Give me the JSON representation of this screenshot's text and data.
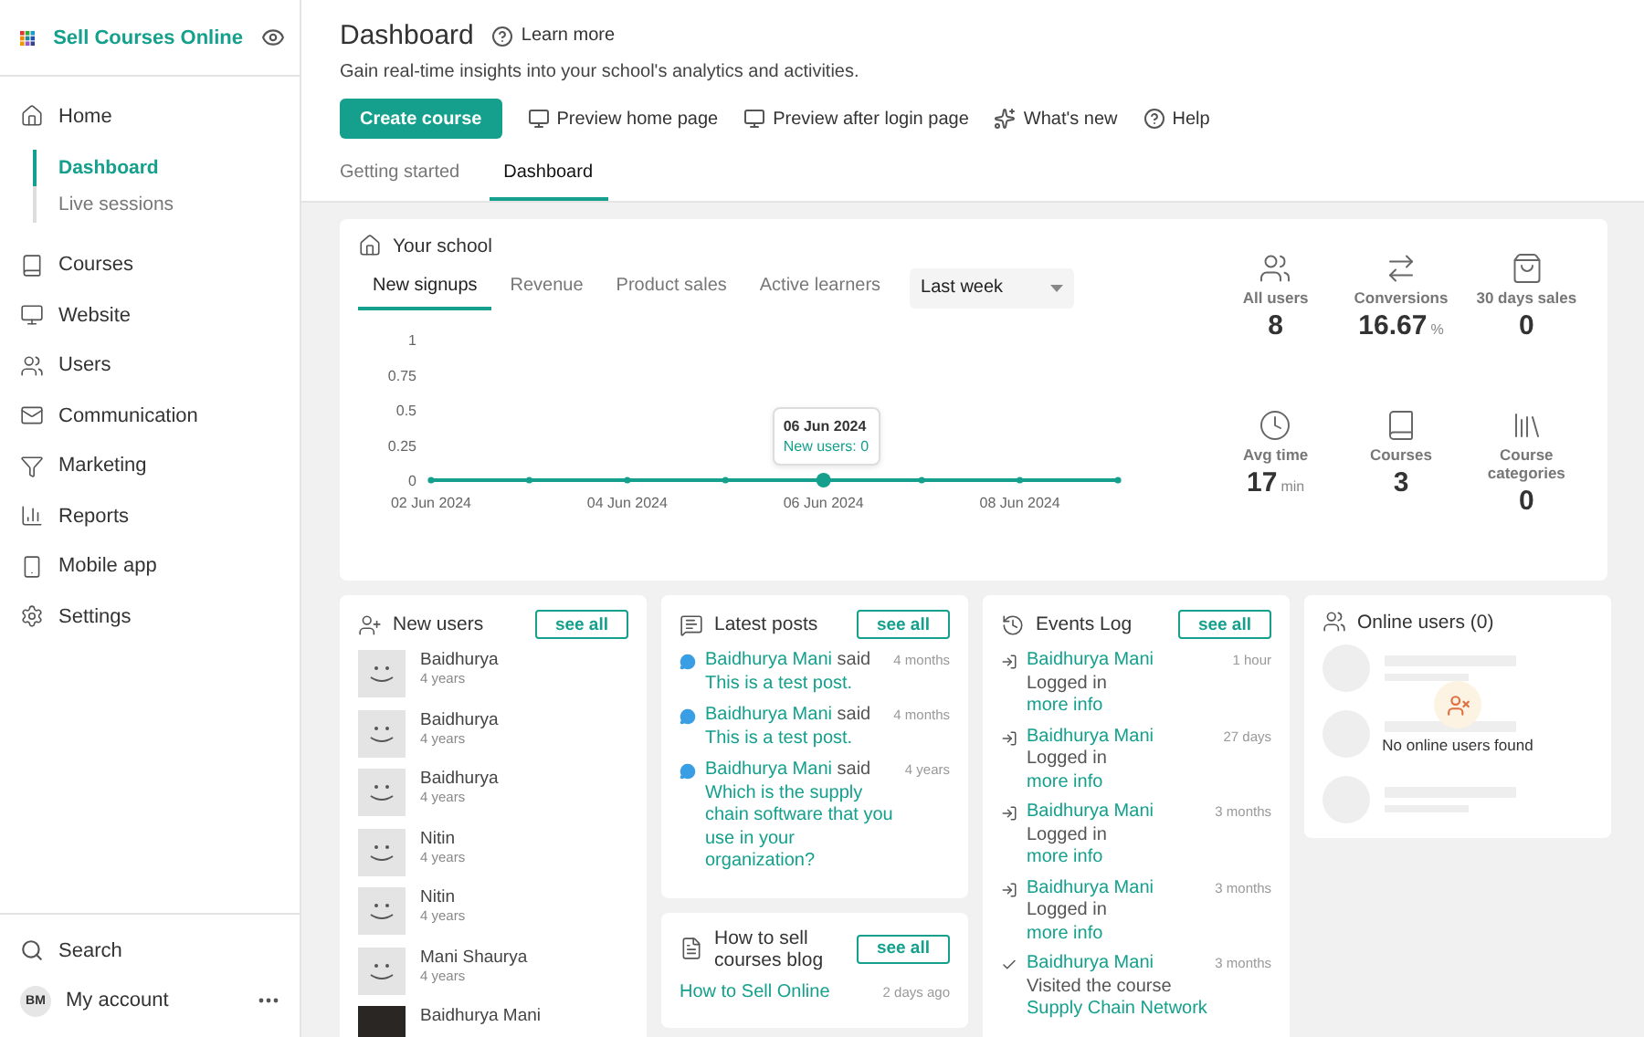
{
  "sidebar": {
    "brand": "Sell Courses Online",
    "items": [
      {
        "label": "Home",
        "selected": false,
        "children": [
          {
            "label": "Dashboard",
            "selected": true
          },
          {
            "label": "Live sessions",
            "selected": false
          }
        ]
      },
      {
        "label": "Courses",
        "selected": false
      },
      {
        "label": "Website",
        "selected": false
      },
      {
        "label": "Users",
        "selected": false
      },
      {
        "label": "Communication",
        "selected": false
      },
      {
        "label": "Marketing",
        "selected": false
      },
      {
        "label": "Reports",
        "selected": false
      },
      {
        "label": "Mobile app",
        "selected": false
      },
      {
        "label": "Settings",
        "selected": false
      }
    ],
    "footer": {
      "search": "Search",
      "account_initials": "BM",
      "account": "My account"
    }
  },
  "header": {
    "title": "Dashboard",
    "learn_more": "Learn more",
    "subtitle": "Gain real-time insights into your school's analytics and activities.",
    "actions": [
      {
        "label": "Create course",
        "kind": "primary"
      },
      {
        "label": "Preview home page",
        "kind": "monitor"
      },
      {
        "label": "Preview after login page",
        "kind": "monitor"
      },
      {
        "label": "What's new",
        "kind": "news"
      },
      {
        "label": "Help",
        "kind": "help"
      }
    ],
    "tabs": [
      {
        "label": "Getting started",
        "selected": false
      },
      {
        "label": "Dashboard",
        "selected": true
      }
    ]
  },
  "school": {
    "title": "Your school",
    "tabs": [
      {
        "label": "New signups",
        "selected": true
      },
      {
        "label": "Revenue",
        "selected": false
      },
      {
        "label": "Product sales",
        "selected": false
      },
      {
        "label": "Active learners",
        "selected": false
      }
    ],
    "period": "Last week",
    "tooltip": {
      "date": "06 Jun 2024",
      "text": "New users: 0"
    },
    "chart_data": {
      "type": "line",
      "categories": [
        "02 Jun 2024",
        null,
        "04 Jun 2024",
        null,
        "06 Jun 2024",
        null,
        "08 Jun 2024",
        null
      ],
      "series": [
        {
          "color": "#14a08c",
          "marker": "circle",
          "values": [
            0,
            0,
            0,
            0,
            0,
            0,
            0,
            0
          ]
        }
      ],
      "ylim": [
        0,
        1
      ],
      "yticks": [
        0,
        0.25,
        0.5,
        0.75,
        1
      ]
    },
    "stats": [
      {
        "label": "All users",
        "value": "8"
      },
      {
        "label": "Conversions",
        "value": "16.67",
        "unit": "%"
      },
      {
        "label": "30 days sales",
        "value": "0"
      },
      {
        "label": "Avg time",
        "value": "17",
        "unit": "min"
      },
      {
        "label": "Courses",
        "value": "3"
      },
      {
        "label": "Course categories",
        "value": "0"
      }
    ]
  },
  "new_users": {
    "title": "New users",
    "see_all": "see all",
    "users": [
      {
        "name": "Baidhurya",
        "age": "4 years",
        "kind": "default"
      },
      {
        "name": "Baidhurya",
        "age": "4 years",
        "kind": "default"
      },
      {
        "name": "Baidhurya",
        "age": "4 years",
        "kind": "default"
      },
      {
        "name": "Nitin",
        "age": "4 years",
        "kind": "default"
      },
      {
        "name": "Nitin",
        "age": "4 years",
        "kind": "default"
      },
      {
        "name": "Mani Shaurya",
        "age": "4 years",
        "kind": "default"
      },
      {
        "name": "Baidhurya Mani",
        "kind": "photo"
      }
    ]
  },
  "latest_posts": {
    "title": "Latest posts",
    "see_all": "see all",
    "posts": [
      {
        "author": "Baidhurya Mani",
        "verb": "said",
        "text": "This is a test post.",
        "time": "4 months"
      },
      {
        "author": "Baidhurya Mani",
        "verb": "said",
        "text": "This is a test post.",
        "time": "4 months"
      },
      {
        "author": "Baidhurya Mani",
        "verb": "said",
        "text": "Which is the supply chain software that you use in your organization?",
        "time": "4 years"
      }
    ]
  },
  "blog": {
    "title": "How to sell courses blog",
    "see_all": "see all",
    "items": [
      {
        "title": "How to Sell Online",
        "time": "2 days ago"
      }
    ]
  },
  "events": {
    "title": "Events Log",
    "see_all": "see all",
    "items": [
      {
        "user": "Baidhurya Mani",
        "action": "Logged in",
        "link": "more info",
        "time": "1 hour",
        "kind": "login"
      },
      {
        "user": "Baidhurya Mani",
        "action": "Logged in",
        "link": "more info",
        "time": "27 days",
        "kind": "login"
      },
      {
        "user": "Baidhurya Mani",
        "action": "Logged in",
        "link": "more info",
        "time": "3 months",
        "kind": "login"
      },
      {
        "user": "Baidhurya Mani",
        "action": "Logged in",
        "link": "more info",
        "time": "3 months",
        "kind": "login"
      },
      {
        "user": "Baidhurya Mani",
        "action": "Visited the course",
        "link": "Supply Chain Network",
        "time": "3 months",
        "kind": "visit"
      }
    ]
  },
  "online_users": {
    "title": "Online users (0)",
    "empty": "No online users found"
  }
}
